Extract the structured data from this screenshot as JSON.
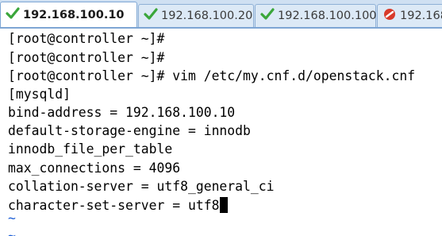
{
  "tabs": [
    {
      "label": "192.168.100.10",
      "status": "connected",
      "active": true
    },
    {
      "label": "192.168.100.20",
      "status": "connected",
      "active": false
    },
    {
      "label": "192.168.100.100",
      "status": "connected",
      "active": false
    },
    {
      "label": "192.168",
      "status": "disconnected",
      "active": false
    }
  ],
  "terminal": {
    "lines": [
      "[root@controller ~]#",
      "[root@controller ~]#",
      "[root@controller ~]# vim /etc/my.cnf.d/openstack.cnf",
      "[mysqld]",
      "bind-address = 192.168.100.10",
      "default-storage-engine = innodb",
      "innodb_file_per_table",
      "max_connections = 4096",
      "collation-server = utf8_general_ci",
      "character-set-server = utf8"
    ],
    "empty_line_marker": "~",
    "empty_line_marker_color": "#1e5fd6",
    "text_color": "#000000",
    "background_color": "#ffffff"
  },
  "colors": {
    "tabbar_bg": "#cfe0f2",
    "connected_icon": "#3aa63a",
    "disconnected_icon": "#d83a2a"
  }
}
